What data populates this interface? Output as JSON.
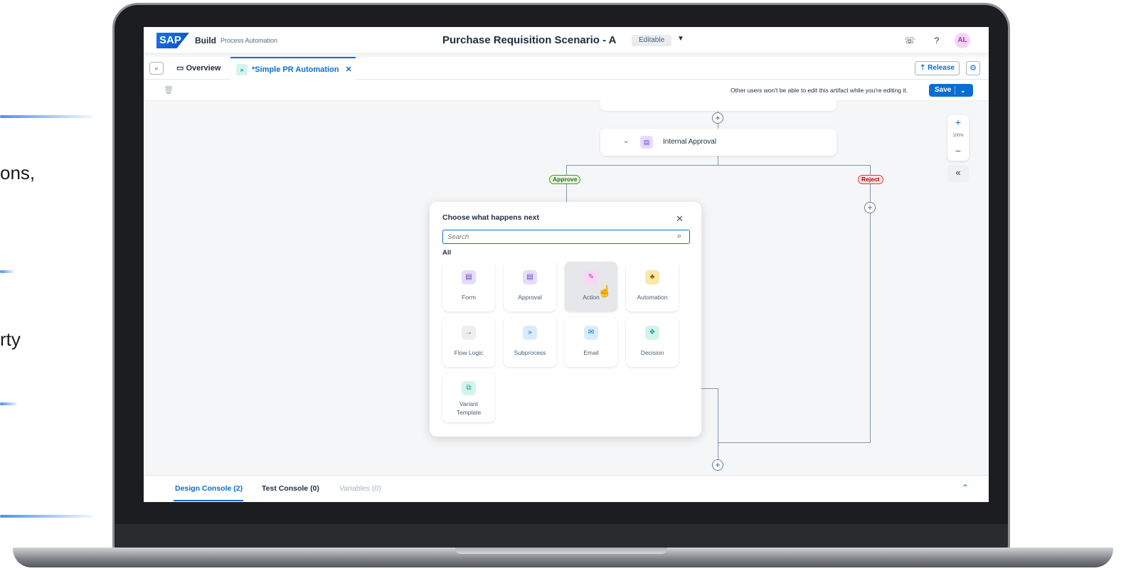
{
  "slide_fragments": [
    "ons,",
    "rty"
  ],
  "shell": {
    "logo": "SAP",
    "brand": "Build",
    "brand_sub": "Process Automation",
    "title": "Purchase Requisition Scenario - A",
    "status": "Editable",
    "avatar": "AL"
  },
  "tabs": {
    "overview": "Overview",
    "active": "*Simple PR Automation",
    "release": "Release"
  },
  "toolbar": {
    "note": "Other users won't be able to edit this artifact while you're editing it.",
    "save": "Save"
  },
  "canvas": {
    "node_label": "Internal Approval",
    "approve_label": "Approve",
    "reject_label": "Reject",
    "zoom": "100%"
  },
  "popover": {
    "title": "Choose what happens next",
    "search_placeholder": "Search",
    "section": "All",
    "tiles": [
      {
        "label": "Form",
        "icon": "form-icon"
      },
      {
        "label": "Approval",
        "icon": "approval-icon"
      },
      {
        "label": "Action",
        "icon": "action-icon"
      },
      {
        "label": "Automation",
        "icon": "automation-icon"
      },
      {
        "label": "Flow Logic",
        "icon": "arrow-right-icon"
      },
      {
        "label": "Subprocess",
        "icon": "subprocess-icon"
      },
      {
        "label": "Email",
        "icon": "email-icon"
      },
      {
        "label": "Decision",
        "icon": "decision-icon"
      },
      {
        "label": "Variant Template",
        "icon": "variant-template-icon"
      }
    ]
  },
  "console": {
    "design": "Design Console (2)",
    "test": "Test Console (0)",
    "variables": "Variables (0)"
  },
  "colors": {
    "accent": "#0a6ed1",
    "approve": "#36a41d",
    "reject": "#d9364c"
  }
}
